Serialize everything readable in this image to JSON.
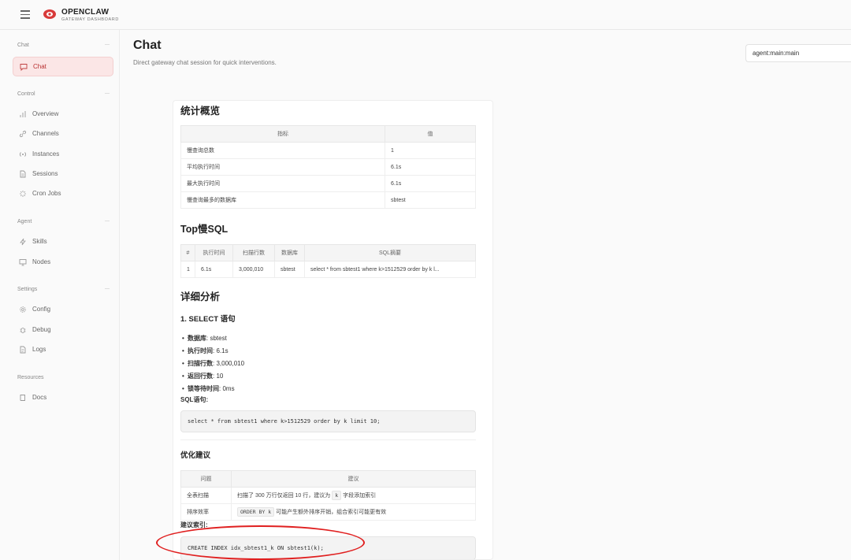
{
  "brand": {
    "title": "OPENCLAW",
    "subtitle": "GATEWAY DASHBOARD"
  },
  "sidebar": {
    "sections": [
      {
        "label": "Chat",
        "items": [
          {
            "label": "Chat",
            "icon": "chat-bubble-icon",
            "active": true
          }
        ]
      },
      {
        "label": "Control",
        "items": [
          {
            "label": "Overview",
            "icon": "bar-chart-icon"
          },
          {
            "label": "Channels",
            "icon": "link-icon"
          },
          {
            "label": "Instances",
            "icon": "radio-signal-icon"
          },
          {
            "label": "Sessions",
            "icon": "document-icon"
          },
          {
            "label": "Cron Jobs",
            "icon": "loader-icon"
          }
        ]
      },
      {
        "label": "Agent",
        "items": [
          {
            "label": "Skills",
            "icon": "lightning-icon"
          },
          {
            "label": "Nodes",
            "icon": "monitor-icon"
          }
        ]
      },
      {
        "label": "Settings",
        "items": [
          {
            "label": "Config",
            "icon": "gear-icon"
          },
          {
            "label": "Debug",
            "icon": "bug-icon"
          },
          {
            "label": "Logs",
            "icon": "file-text-icon"
          }
        ]
      },
      {
        "label": "Resources",
        "items": [
          {
            "label": "Docs",
            "icon": "book-icon"
          }
        ]
      }
    ]
  },
  "header": {
    "title": "Chat",
    "subtitle": "Direct gateway chat session for quick interventions.",
    "session": "agent:main:main"
  },
  "message": {
    "stats_heading": "统计概览",
    "stats_table": {
      "headers": [
        "指标",
        "值"
      ],
      "rows": [
        [
          "慢查询总数",
          "1"
        ],
        [
          "平均执行时间",
          "6.1s"
        ],
        [
          "最大执行时间",
          "6.1s"
        ],
        [
          "慢查询最多的数据库",
          "sbtest"
        ]
      ]
    },
    "top_heading": "Top慢SQL",
    "top_table": {
      "headers": [
        "#",
        "执行时间",
        "扫描行数",
        "数据库",
        "SQL摘要"
      ],
      "rows": [
        [
          "1",
          "6.1s",
          "3,000,010",
          "sbtest",
          "select * from sbtest1 where k>1512529 order by k l..."
        ]
      ]
    },
    "detail_heading": "详细分析",
    "stmt_heading": "1. SELECT 语句",
    "bullets": [
      {
        "k": "数据库",
        "v": ": sbtest"
      },
      {
        "k": "执行时间",
        "v": ": 6.1s"
      },
      {
        "k": "扫描行数",
        "v": ": 3,000,010"
      },
      {
        "k": "返回行数",
        "v": ": 10"
      },
      {
        "k": "锁等待时间",
        "v": ": 0ms"
      }
    ],
    "sql_label": "SQL语句:",
    "sql": "select * from sbtest1 where k>1512529 order by k limit 10;",
    "opt_heading": "优化建议",
    "opt_table": {
      "headers": [
        "问题",
        "建议"
      ],
      "row1": {
        "issue": "全表扫描",
        "pre": "扫描了 300 万行仅返回 10 行，建议为",
        "code": "k",
        "post": "字段添加索引"
      },
      "row2": {
        "issue": "排序效率",
        "code": "ORDER BY k",
        "post": "可能产生额外排序开销，组合索引可能更有效"
      }
    },
    "index_label": "建议索引:",
    "index_sql": "CREATE INDEX idx_sbtest1_k ON sbtest1(k);"
  },
  "colors": {
    "accent": "#c04040",
    "annotation": "#e02020"
  }
}
